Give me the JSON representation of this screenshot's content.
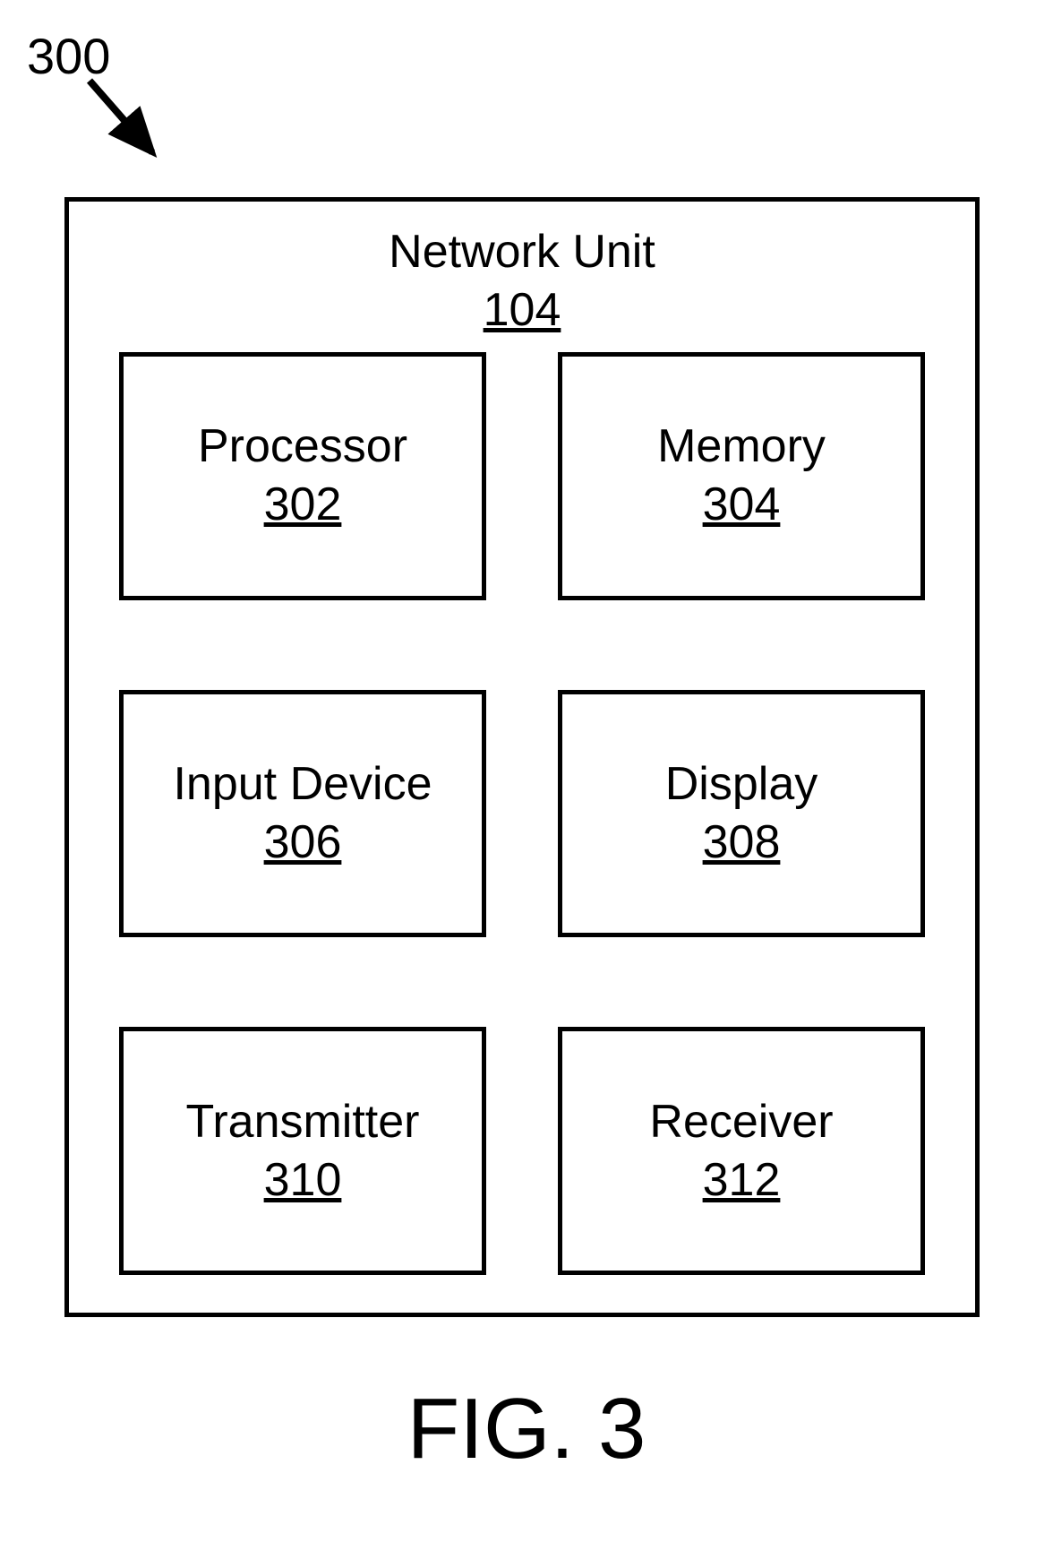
{
  "figure": {
    "ref_label": "300",
    "caption": "FIG. 3",
    "container": {
      "title": "Network Unit",
      "ref": "104"
    },
    "blocks": [
      {
        "label": "Processor",
        "ref": "302"
      },
      {
        "label": "Memory",
        "ref": "304"
      },
      {
        "label": "Input Device",
        "ref": "306"
      },
      {
        "label": "Display",
        "ref": "308"
      },
      {
        "label": "Transmitter",
        "ref": "310"
      },
      {
        "label": "Receiver",
        "ref": "312"
      }
    ]
  }
}
